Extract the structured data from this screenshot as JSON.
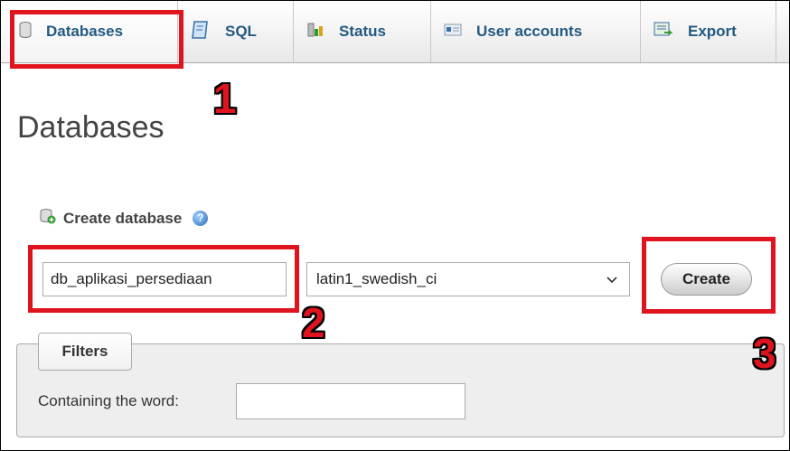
{
  "tabs": [
    {
      "label": "Databases",
      "icon": "database-icon"
    },
    {
      "label": "SQL",
      "icon": "sql-icon"
    },
    {
      "label": "Status",
      "icon": "status-chart-icon"
    },
    {
      "label": "User accounts",
      "icon": "user-accounts-icon"
    },
    {
      "label": "Export",
      "icon": "export-icon"
    }
  ],
  "page": {
    "title": "Databases"
  },
  "create_db": {
    "heading": "Create database",
    "name_value": "db_aplikasi_persediaan",
    "collation_value": "latin1_swedish_ci",
    "create_label": "Create"
  },
  "filters": {
    "legend": "Filters",
    "label": "Containing the word:",
    "value": ""
  },
  "annotations": {
    "n1": "1",
    "n2": "2",
    "n3": "3"
  },
  "colors": {
    "annotation": "#e0141e",
    "tab_text": "#235a81"
  }
}
